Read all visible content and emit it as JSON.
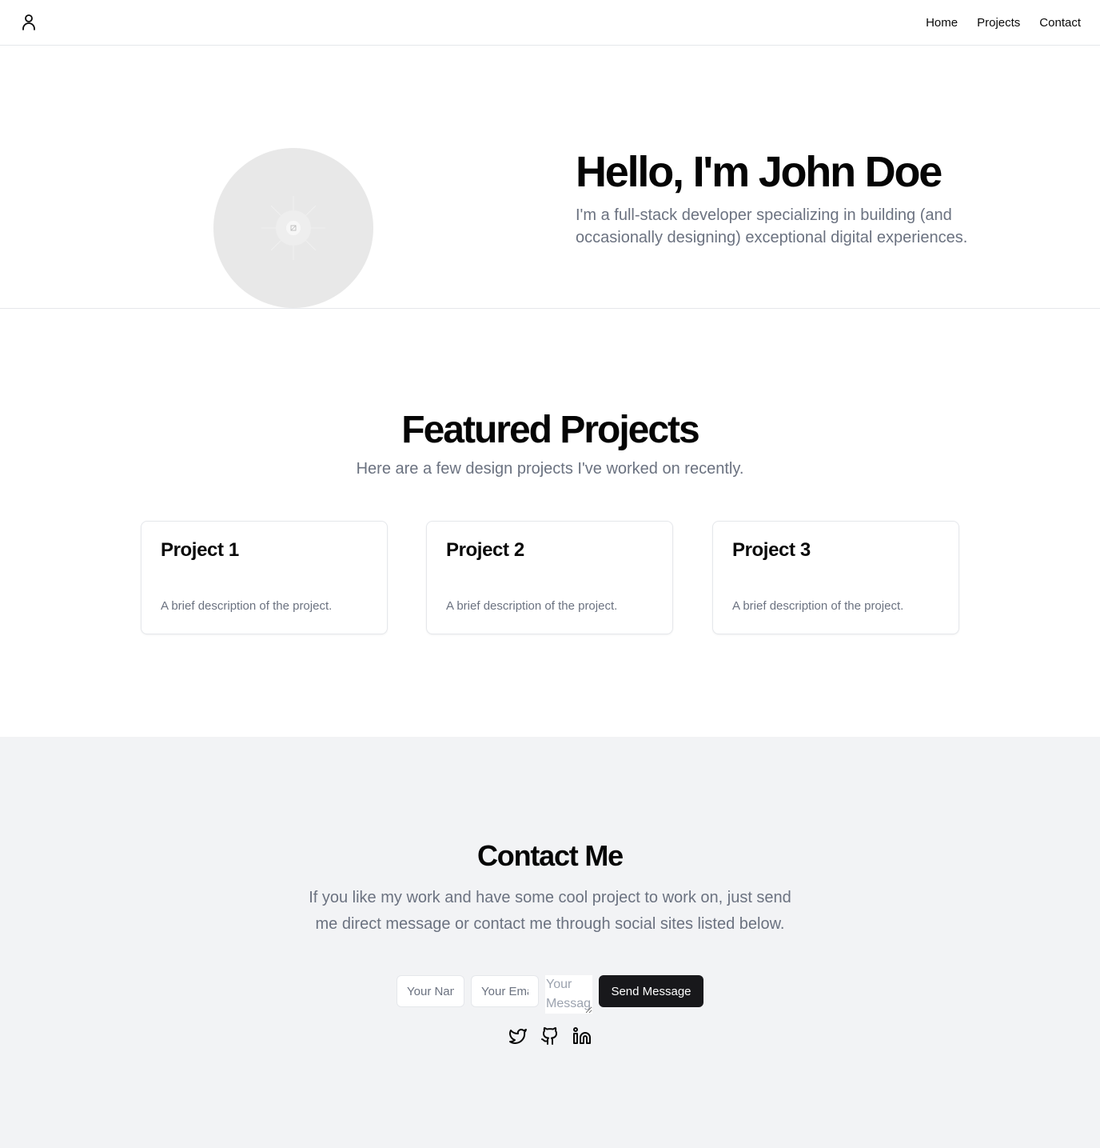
{
  "header": {
    "logo_icon": "user-icon",
    "nav": [
      {
        "label": "Home"
      },
      {
        "label": "Projects"
      },
      {
        "label": "Contact"
      }
    ]
  },
  "hero": {
    "avatar_icon": "image-placeholder-icon",
    "title": "Hello, I'm John Doe",
    "subtitle": "I'm a full-stack developer specializing in building (and occasionally designing) exceptional digital experiences."
  },
  "projects": {
    "title": "Featured Projects",
    "subtitle": "Here are a few design projects I've worked on recently.",
    "items": [
      {
        "title": "Project 1",
        "description": "A brief description of the project."
      },
      {
        "title": "Project 2",
        "description": "A brief description of the project."
      },
      {
        "title": "Project 3",
        "description": "A brief description of the project."
      }
    ]
  },
  "contact": {
    "title": "Contact Me",
    "subtitle": "If you like my work and have some cool project to work on, just send me direct message or contact me through social sites listed below.",
    "form": {
      "name_placeholder": "Your Name",
      "email_placeholder": "Your Email",
      "message_placeholder": "Your Message",
      "send_label": "Send Message"
    },
    "socials": [
      {
        "icon": "twitter-icon"
      },
      {
        "icon": "github-icon"
      },
      {
        "icon": "linkedin-icon"
      }
    ]
  },
  "colors": {
    "text": "#0a0a0a",
    "muted": "#6b7280",
    "border": "#e5e7eb",
    "contact_bg": "#f2f3f5",
    "button_bg": "#18181b"
  }
}
